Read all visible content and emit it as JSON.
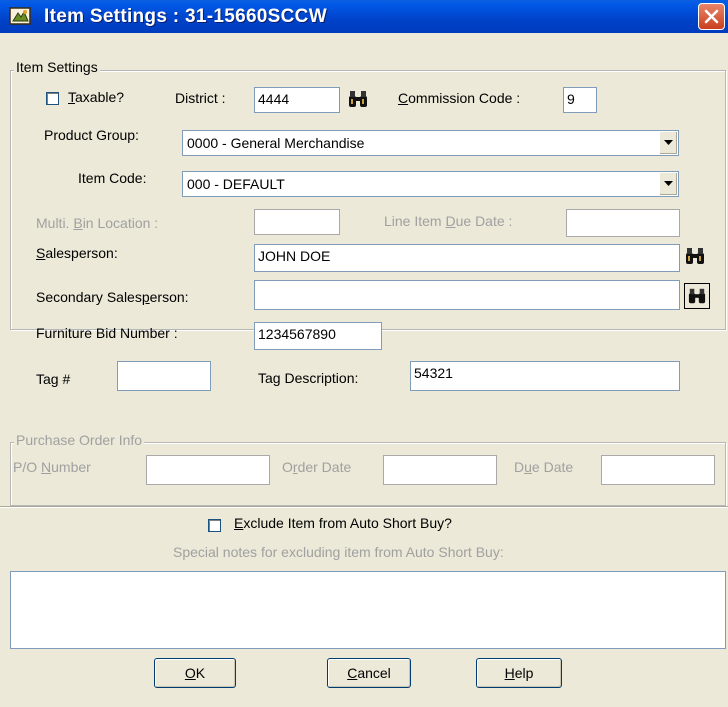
{
  "window": {
    "title": "Item Settings : 31-15660SCCW",
    "icon": "app-window-icon",
    "close_icon": "close-icon"
  },
  "item_settings": {
    "group_label": "Item Settings",
    "taxable": {
      "accel": "T",
      "rest": "axable?",
      "checked": false
    },
    "district_label": "District :",
    "district_value": "4444",
    "commission": {
      "pre": "",
      "accel": "C",
      "rest": "ommission Code :"
    },
    "commission_value": "9",
    "product_group_label": "Product Group:",
    "product_group_value": "0000 - General Merchandise",
    "item_code_label": "Item Code:",
    "item_code_value": "000 - DEFAULT",
    "multi_bin": {
      "pre": "Multi. ",
      "accel": "B",
      "rest": "in Location :"
    },
    "multi_bin_value": "",
    "line_due": {
      "pre": "Line Item ",
      "accel": "D",
      "rest": "ue Date :"
    },
    "line_due_value": "",
    "salesperson": {
      "pre": "",
      "accel": "S",
      "rest": "alesperson:"
    },
    "salesperson_value": "JOHN DOE",
    "secondary": {
      "pre": "Secondary Sales",
      "accel": "p",
      "rest": "erson:"
    },
    "secondary_value": "",
    "furniture_bid_label": "Furniture Bid Number :",
    "furniture_bid_value": "1234567890",
    "tag": {
      "pre": "Ta",
      "accel": "g",
      "rest": " #"
    },
    "tag_value": "",
    "tag_description_label": "Tag Description:",
    "tag_description_value": "54321"
  },
  "purchase_order": {
    "group_label": "Purchase Order Info",
    "po_number": {
      "pre": "P/O ",
      "accel": "N",
      "rest": "umber"
    },
    "po_number_value": "",
    "order_date": {
      "pre": "O",
      "accel": "r",
      "rest": "der Date"
    },
    "order_date_value": "",
    "due_date": {
      "pre": "D",
      "accel": "u",
      "rest": "e Date"
    },
    "due_date_value": ""
  },
  "auto_short_buy": {
    "exclude": {
      "pre": "",
      "accel": "E",
      "rest": "xclude Item from Auto Short Buy?",
      "checked": false
    },
    "notes_label": "Special notes for excluding item from Auto Short Buy:",
    "notes_value": ""
  },
  "buttons": {
    "ok": {
      "accel": "O",
      "rest": "K"
    },
    "cancel": {
      "accel": "C",
      "rest": "ancel"
    },
    "help": {
      "accel": "H",
      "rest": "elp"
    }
  },
  "colors": {
    "titlebar": "#0054e3",
    "dialog_bg": "#ece9d8",
    "close_button": "#d9542f"
  }
}
